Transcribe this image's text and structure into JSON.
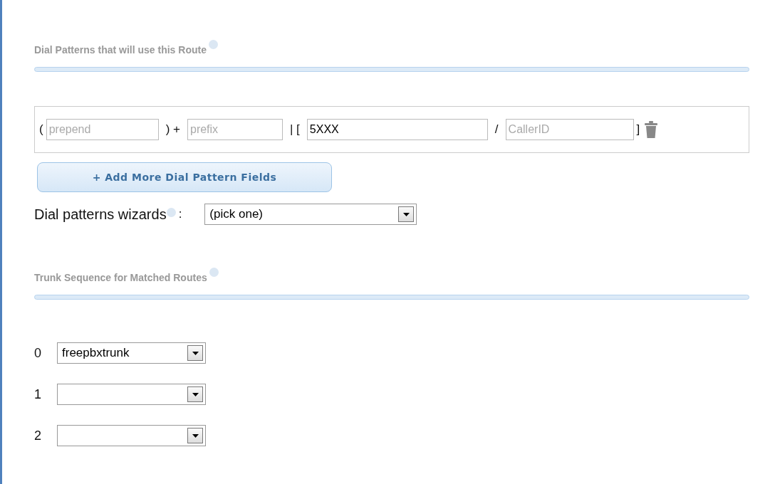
{
  "dial_patterns": {
    "title": "Dial Patterns that will use this Route",
    "rows": [
      {
        "open_paren": "(",
        "prepend": {
          "placeholder": "prepend"
        },
        "plus": ") +",
        "prefix": {
          "placeholder": "prefix"
        },
        "bracket_open": "| [",
        "match_pattern": {
          "value": "5XXX"
        },
        "slash": "/",
        "callerid": {
          "placeholder": "CallerID"
        },
        "bracket_close": "]"
      }
    ]
  },
  "add_button": {
    "label": "+ Add More Dial Pattern Fields"
  },
  "wizard": {
    "label": "Dial patterns wizards",
    "colon": ":",
    "select": "(pick one)"
  },
  "trunk_sequence": {
    "title": "Trunk Sequence for Matched Routes",
    "rows": [
      {
        "index": "0",
        "value": "freepbxtrunk"
      },
      {
        "index": "1"
      },
      {
        "index": "2"
      }
    ]
  }
}
